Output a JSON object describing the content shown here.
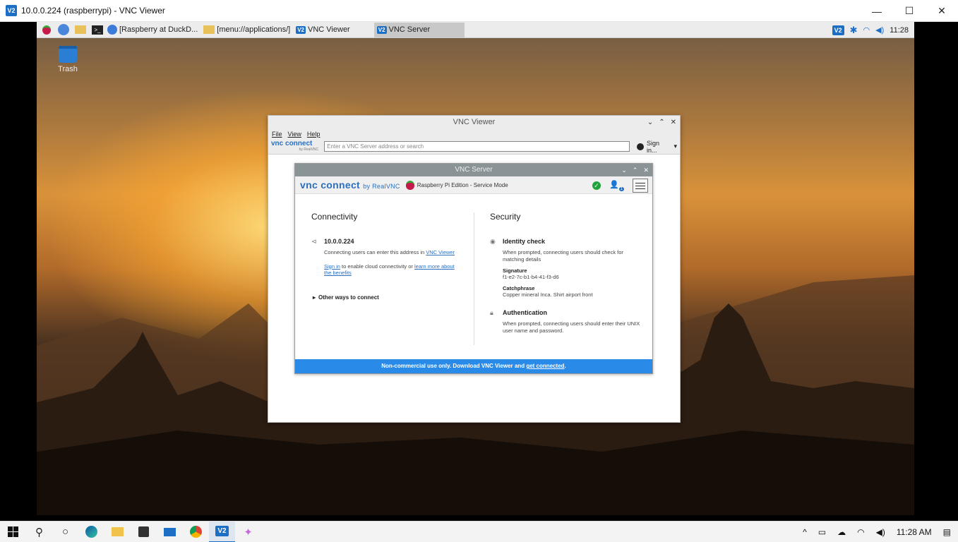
{
  "outer_window": {
    "icon": "V2",
    "title": "10.0.0.224 (raspberrypi) - VNC Viewer",
    "minimize": "—",
    "maximize": "☐",
    "close": "✕"
  },
  "pi_taskbar": {
    "buttons": [
      {
        "label": "[Raspberry at DuckD..."
      },
      {
        "label": "[menu://applications/]"
      },
      {
        "label": "VNC Viewer"
      },
      {
        "label": "VNC Server"
      }
    ],
    "vnc_icon": "V2",
    "clock": "11:28"
  },
  "desktop": {
    "trash_label": "Trash"
  },
  "vnc_viewer": {
    "title": "VNC Viewer",
    "menu": [
      "File",
      "View",
      "Help"
    ],
    "logo_text": "vnc connect",
    "logo_sub": "by RealVNC",
    "address_placeholder": "Enter a VNC Server address or search",
    "sign_in": "Sign in..."
  },
  "vnc_server": {
    "title": "VNC Server",
    "brand": "vnc connect",
    "brand_sub": "by RealVNC",
    "edition": "Raspberry Pi Edition - Service Mode",
    "user_count": "1",
    "connectivity": {
      "heading": "Connectivity",
      "address": "10.0.0.224",
      "address_desc": "Connecting users can enter this address in",
      "viewer_link": "VNC Viewer",
      "sign_in_link": "Sign in",
      "sign_in_text": "to enable cloud connectivity or",
      "learn_more_link": "learn more about the benefits",
      "other_ways": "Other ways to connect"
    },
    "security": {
      "heading": "Security",
      "identity_check": "Identity check",
      "identity_desc": "When prompted, connecting users should check for matching details",
      "signature_label": "Signature",
      "signature_value": "f1-e2-7c-b1-b4-41-f3-d6",
      "catchphrase_label": "Catchphrase",
      "catchphrase_value": "Copper mineral Inca. Shirt airport front",
      "authentication": "Authentication",
      "auth_desc": "When prompted, connecting users should enter their UNIX user name and password."
    },
    "footer_text": "Non-commercial use only. Download VNC Viewer and",
    "footer_link": "get connected",
    "footer_end": "."
  },
  "windows_taskbar": {
    "clock": "11:28 AM"
  },
  "colors": {
    "vnc_blue": "#2a6fc0",
    "footer_blue": "#2a8ae8",
    "status_green": "#1fa33a"
  }
}
